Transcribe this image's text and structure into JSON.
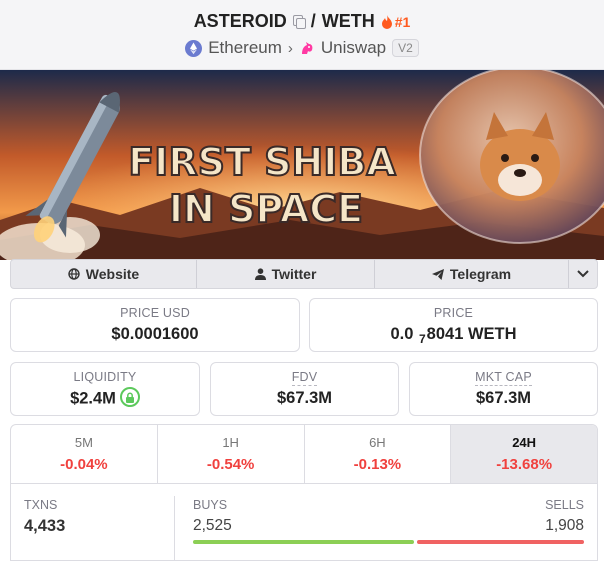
{
  "header": {
    "base_token": "ASTEROID",
    "separator": "/",
    "quote_token": "WETH",
    "rank": "#1",
    "chain": "Ethereum",
    "dex": "Uniswap",
    "dex_version": "V2"
  },
  "banner": {
    "line1": "FIRST SHIBA",
    "line2": "IN SPACE"
  },
  "links": {
    "website": "Website",
    "twitter": "Twitter",
    "telegram": "Telegram"
  },
  "stats": {
    "price_usd_label": "PRICE USD",
    "price_usd": "$0.0001600",
    "price_label": "PRICE",
    "price_prefix": "0.0",
    "price_zeros": "7",
    "price_digits": "8041 WETH",
    "liquidity_label": "LIQUIDITY",
    "liquidity": "$2.4M",
    "fdv_label": "FDV",
    "fdv": "$67.3M",
    "mktcap_label": "MKT CAP",
    "mktcap": "$67.3M"
  },
  "timeframes": [
    {
      "label": "5M",
      "change": "-0.04%"
    },
    {
      "label": "1H",
      "change": "-0.54%"
    },
    {
      "label": "6H",
      "change": "-0.13%"
    },
    {
      "label": "24H",
      "change": "-13.68%"
    }
  ],
  "txns": {
    "txns_label": "TXNS",
    "txns": "4,433",
    "buys_label": "BUYS",
    "buys": "2,525",
    "sells_label": "SELLS",
    "sells": "1,908",
    "buy_ratio": 0.5696
  },
  "colors": {
    "negative": "#f0413e",
    "buy_bar": "#8ccf55",
    "sell_bar": "#f06262",
    "rank": "#ff5a1f",
    "lock": "#5cc95c"
  }
}
